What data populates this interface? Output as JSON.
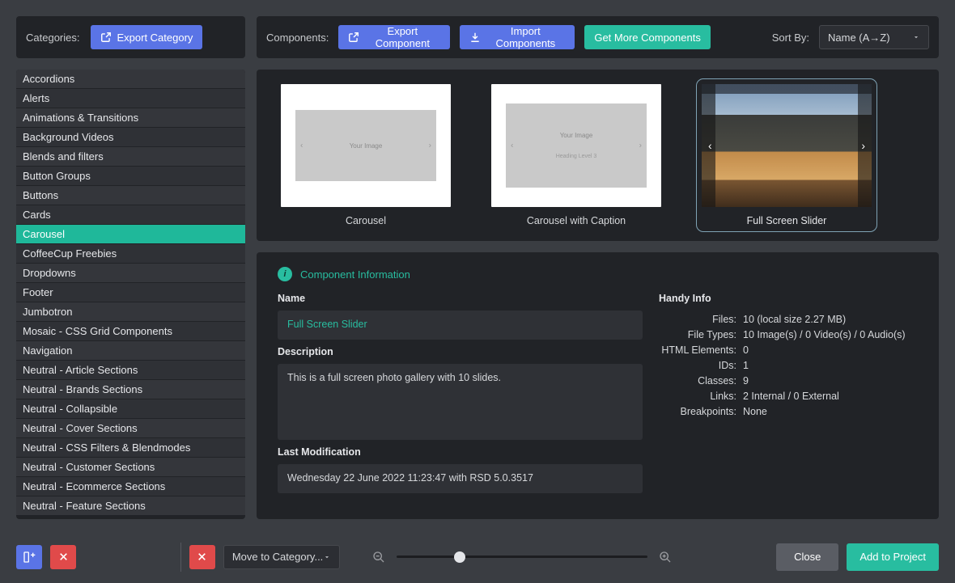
{
  "topbar": {
    "categories_label": "Categories:",
    "export_category": "Export Category",
    "components_label": "Components:",
    "export_components": "Export Component",
    "import_components": "Import Components",
    "get_more": "Get More Components",
    "sort_by_label": "Sort By:",
    "sort_value": "Name (A→Z)"
  },
  "categories": [
    "Accordions",
    "Alerts",
    "Animations & Transitions",
    "Background Videos",
    "Blends and filters",
    "Button Groups",
    "Buttons",
    "Cards",
    "Carousel",
    "CoffeeCup Freebies",
    "Dropdowns",
    "Footer",
    "Jumbotron",
    "Mosaic - CSS Grid Components",
    "Navigation",
    "Neutral - Article Sections",
    "Neutral - Brands Sections",
    "Neutral - Collapsible",
    "Neutral - Cover Sections",
    "Neutral - CSS Filters & Blendmodes",
    "Neutral - Customer Sections",
    "Neutral - Ecommerce Sections",
    "Neutral - Feature Sections"
  ],
  "categories_active_index": 8,
  "thumbs": [
    {
      "label": "Carousel",
      "placeholder": "Your Image"
    },
    {
      "label": "Carousel with Caption",
      "placeholder": "Your Image",
      "caption": "Heading Level 3"
    },
    {
      "label": "Full Screen Slider"
    }
  ],
  "thumbs_selected_index": 2,
  "info": {
    "section_title": "Component Information",
    "name_label": "Name",
    "name_value": "Full Screen Slider",
    "desc_label": "Description",
    "desc_value": "This is a full screen photo gallery with 10 slides.",
    "mod_label": "Last Modification",
    "mod_value": "Wednesday 22 June 2022 11:23:47 with RSD 5.0.3517",
    "handy_label": "Handy Info",
    "handy": [
      {
        "k": "Files:",
        "v": "10 (local size 2.27 MB)"
      },
      {
        "k": "File Types:",
        "v": "10 Image(s) / 0 Video(s) / 0 Audio(s)"
      },
      {
        "k": "HTML Elements:",
        "v": "0"
      },
      {
        "k": "IDs:",
        "v": "1"
      },
      {
        "k": "Classes:",
        "v": "9"
      },
      {
        "k": "Links:",
        "v": "2 Internal / 0 External"
      },
      {
        "k": "Breakpoints:",
        "v": "None"
      }
    ]
  },
  "footer": {
    "move_to": "Move to Category...",
    "close": "Close",
    "add": "Add to Project"
  }
}
